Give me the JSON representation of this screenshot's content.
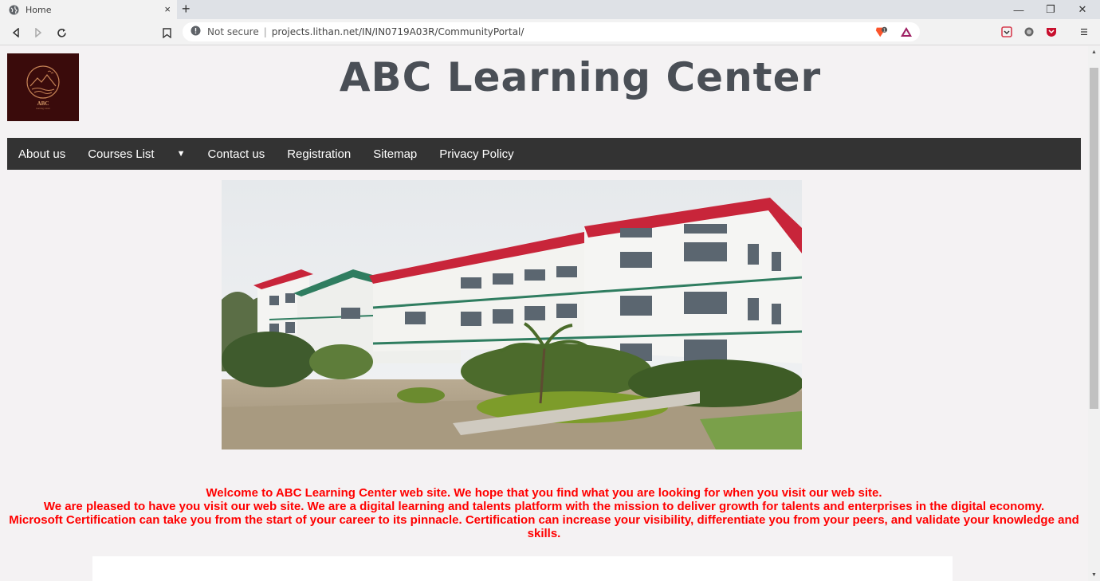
{
  "browser": {
    "tab_title": "Home",
    "tab_close": "×",
    "new_tab": "+",
    "security_label": "Not secure",
    "address_separator": "|",
    "url": "projects.lithan.net/IN/IN0719A03R/CommunityPortal/",
    "window_minimize": "—",
    "window_restore": "❐",
    "window_close": "✕"
  },
  "site": {
    "logo_text": "ABC",
    "logo_subtext": "learning center",
    "title": "ABC Learning Center"
  },
  "nav": {
    "items": [
      {
        "label": "About us"
      },
      {
        "label": "Courses List"
      },
      {
        "label": "Contact us"
      },
      {
        "label": "Registration"
      },
      {
        "label": "Sitemap"
      },
      {
        "label": "Privacy Policy"
      }
    ],
    "dropdown_caret": "▼"
  },
  "welcome": {
    "line1": "Welcome to ABC Learning Center web site. We hope that you find what you are looking for when you visit our web site.",
    "line2": "We are pleased to have you visit our web site. We are a digital learning and talents platform with the mission to deliver growth for talents and enterprises in the digital economy.",
    "line3": "Microsoft Certification can take you from the start of your career to its pinnacle. Certification can increase your visibility, differentiate you from your peers, and validate your knowledge and skills."
  },
  "colors": {
    "nav_bg": "#333333",
    "title_color": "#4a4f56",
    "welcome_color": "#ff0000",
    "page_bg": "#f4f2f3",
    "logo_bg": "#3a0b0b"
  },
  "icons": {
    "favicon": "globe-icon",
    "back": "back-arrow-icon",
    "forward": "forward-arrow-icon",
    "reload": "reload-icon",
    "bookmark": "bookmark-icon",
    "warning": "warning-circle-icon",
    "brave": "brave-shield-icon",
    "rewards": "brave-rewards-icon",
    "ext1": "pocket-extension-icon",
    "ext2": "record-extension-icon",
    "ext3": "shield-extension-icon",
    "menu": "menu-icon"
  }
}
